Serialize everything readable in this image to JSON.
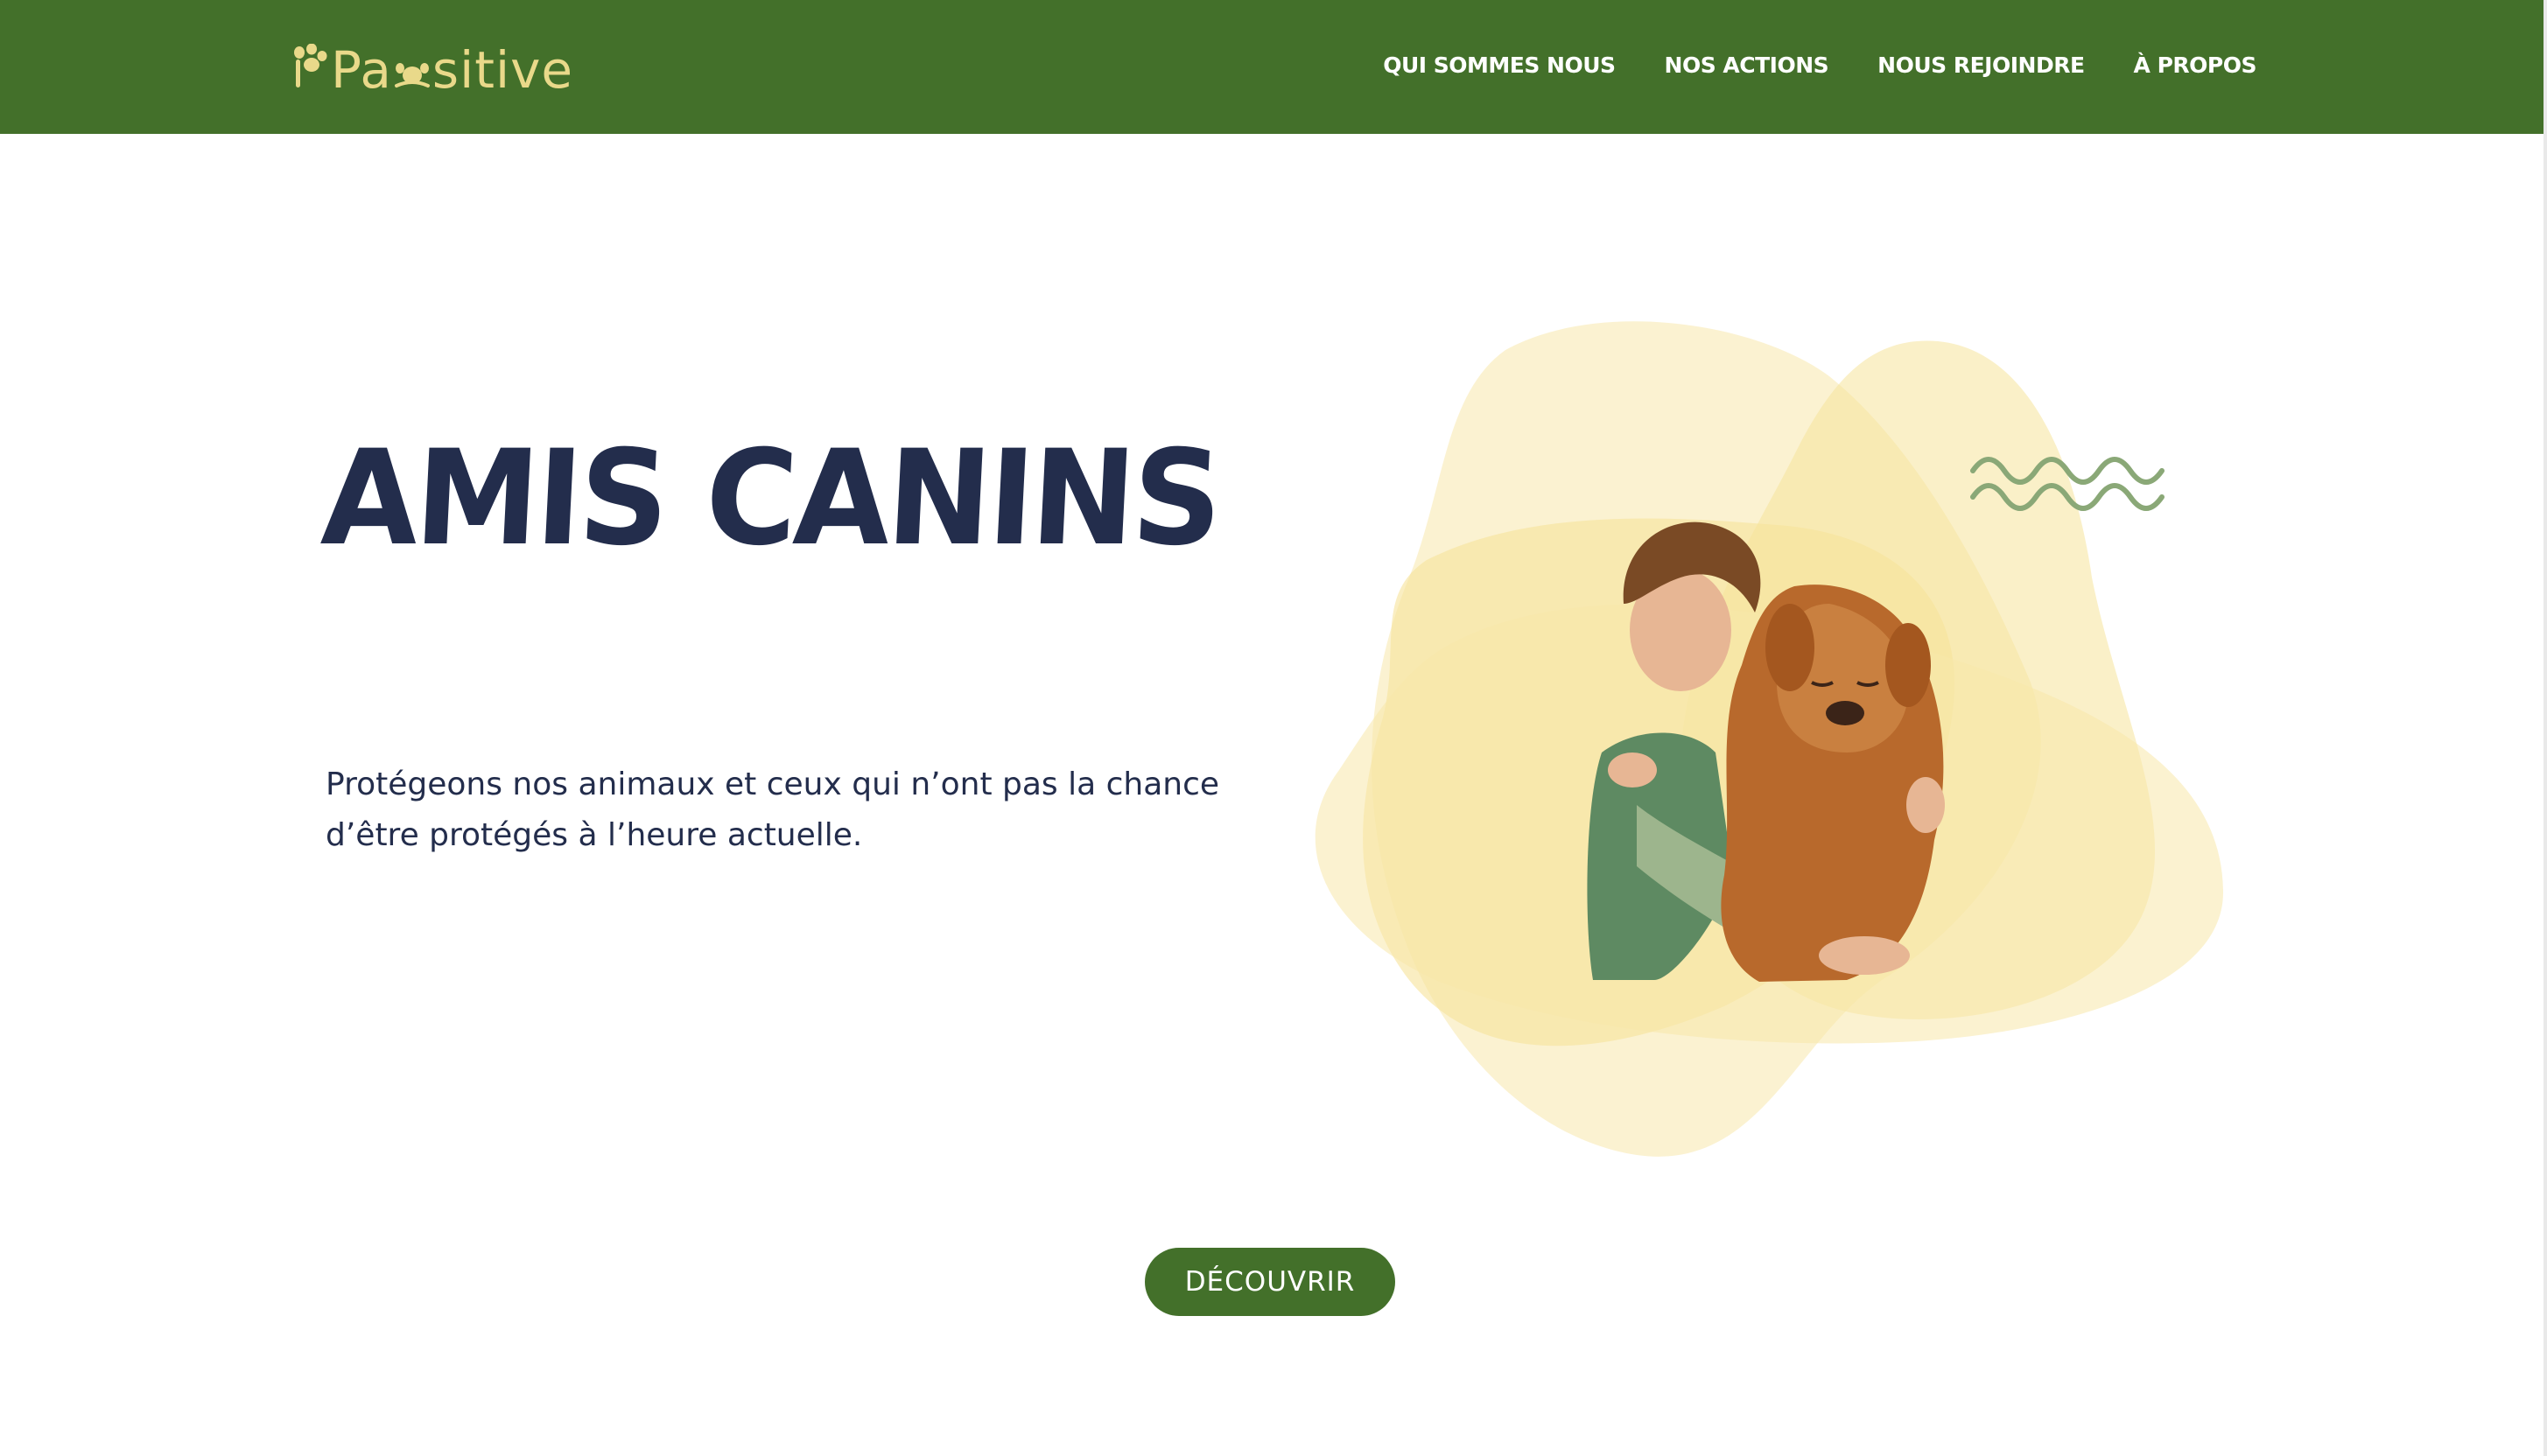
{
  "header": {
    "logo_text": "Pa sitive",
    "logo_prefix": "Pa",
    "logo_suffix": "sitive",
    "nav": [
      {
        "label": "QUI SOMMES NOUS"
      },
      {
        "label": "NOS ACTIONS"
      },
      {
        "label": "NOUS REJOINDRE"
      },
      {
        "label": "À PROPOS"
      }
    ]
  },
  "hero": {
    "title": "AMIS CANINS",
    "subtitle": "Protégeons nos animaux et ceux qui n’ont pas la chance d’être protégés à l’heure actuelle.",
    "cta_label": "DÉCOUVRIR"
  },
  "icons": {
    "logo_mark": "paw-icon",
    "decoration": "wave-icon"
  },
  "colors": {
    "brand_green": "#43702a",
    "heading_navy": "#232d4c",
    "logo_yellow": "#e9d98a",
    "blob_yellow": "#f6e39a",
    "wave_green": "#8aa877"
  }
}
